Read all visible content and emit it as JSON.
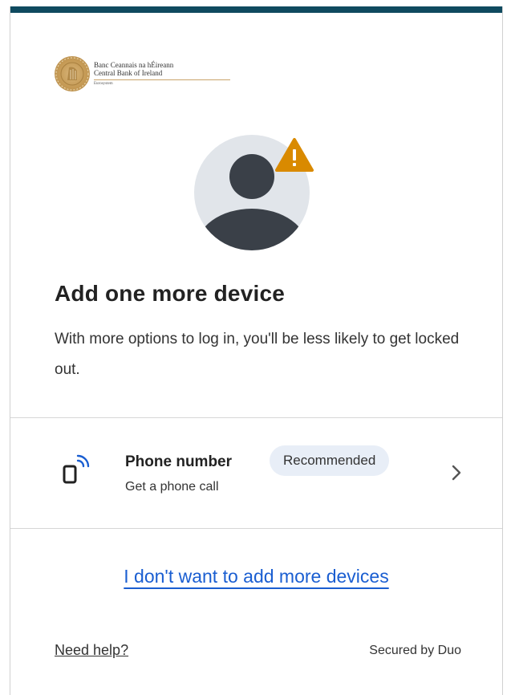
{
  "brand": {
    "name_irish": "Banc Ceannais na hÉireann",
    "name_english": "Central Bank of Ireland",
    "tagline": "Eurosystem",
    "bar_color": "#0f4a5f"
  },
  "main": {
    "title": "Add one more device",
    "description": "With more options to log in, you'll be less likely to get locked out."
  },
  "options": [
    {
      "icon": "phone-icon",
      "label": "Phone number",
      "badge": "Recommended",
      "sublabel": "Get a phone call"
    }
  ],
  "skip_link": "I don't want to add more devices",
  "footer": {
    "help": "Need help?",
    "secured": "Secured by Duo"
  },
  "colors": {
    "warning": "#d98a00",
    "link": "#1a5ed1",
    "avatar_bg": "#e1e5ea",
    "avatar_fg": "#3a4048",
    "badge_bg": "#e8eef7"
  }
}
